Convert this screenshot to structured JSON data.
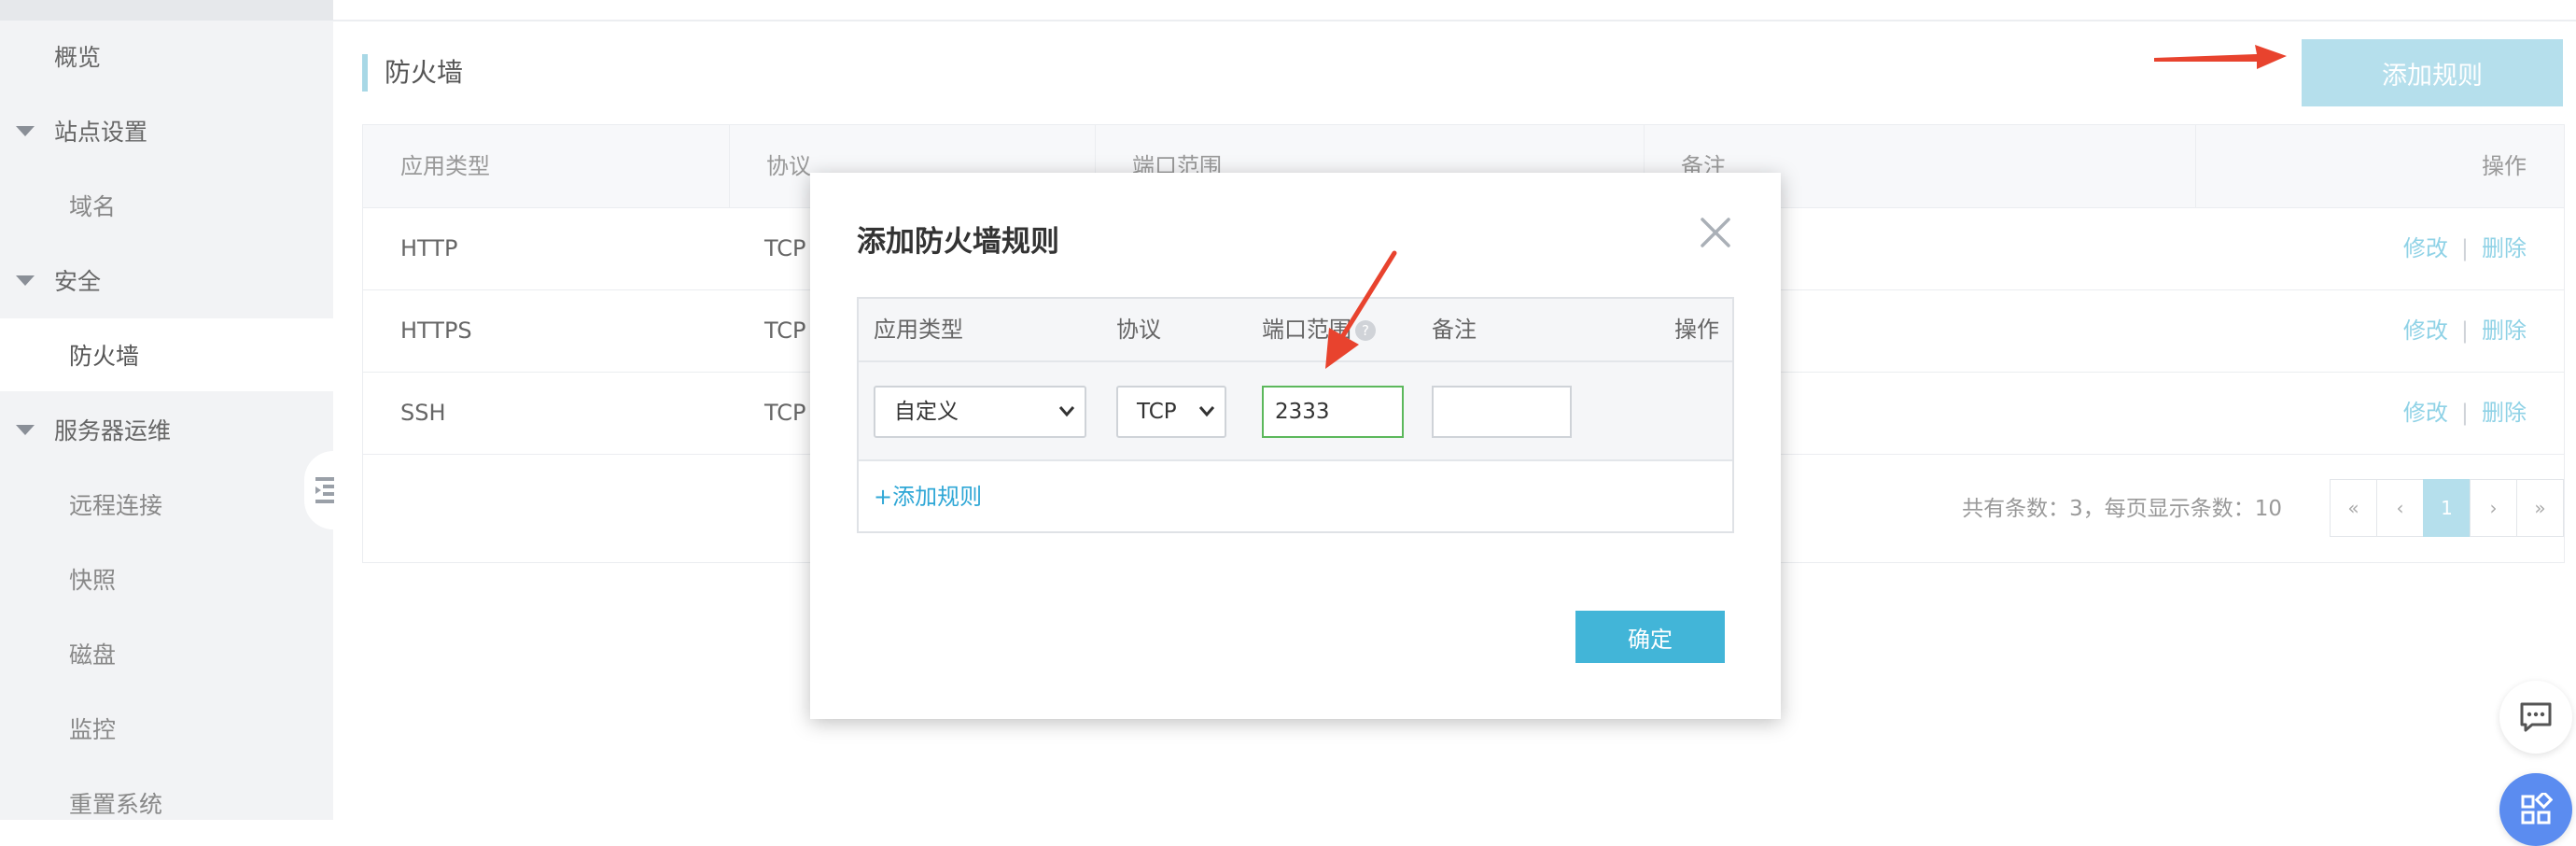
{
  "sidebar": {
    "items": [
      {
        "label": "概览",
        "level": 1
      },
      {
        "label": "站点设置",
        "level": 0
      },
      {
        "label": "域名",
        "level": 2
      },
      {
        "label": "安全",
        "level": 0
      },
      {
        "label": "防火墙",
        "level": 2,
        "active": true
      },
      {
        "label": "服务器运维",
        "level": 0
      },
      {
        "label": "远程连接",
        "level": 2
      },
      {
        "label": "快照",
        "level": 2
      },
      {
        "label": "磁盘",
        "level": 2
      },
      {
        "label": "监控",
        "level": 2
      },
      {
        "label": "重置系统",
        "level": 2
      }
    ]
  },
  "main": {
    "section_title": "防火墙",
    "add_rule_label": "添加规则",
    "table": {
      "headers": [
        "应用类型",
        "协议",
        "端口范围",
        "备注",
        "操作"
      ],
      "rows": [
        {
          "app": "HTTP",
          "protocol": "TCP"
        },
        {
          "app": "HTTPS",
          "protocol": "TCP"
        },
        {
          "app": "SSH",
          "protocol": "TCP"
        }
      ],
      "edit_label": "修改",
      "delete_label": "删除",
      "separator": "|"
    },
    "footer": {
      "summary": "共有条数：3，每页显示条数：10",
      "pager": [
        "«",
        "‹",
        "1",
        "›",
        "»"
      ],
      "current_page": "1"
    }
  },
  "modal": {
    "title": "添加防火墙规则",
    "headers": [
      "应用类型",
      "协议",
      "端口范围",
      "备注",
      "操作"
    ],
    "help_icon": "?",
    "row": {
      "app_type": "自定义",
      "protocol": "TCP",
      "port": "2333",
      "note": ""
    },
    "add_rule_link": "+添加规则",
    "confirm_label": "确定"
  },
  "colors": {
    "accent": "#42b5d8",
    "accent_light": "#b5dfec",
    "link": "#8fd2e6",
    "focus_border": "#5cb85c",
    "annotation_arrow": "#e8432e"
  },
  "icons": [
    "collapse-sidebar-icon",
    "close-icon",
    "chevron-down-icon",
    "chat-icon",
    "apps-icon",
    "help-icon"
  ]
}
